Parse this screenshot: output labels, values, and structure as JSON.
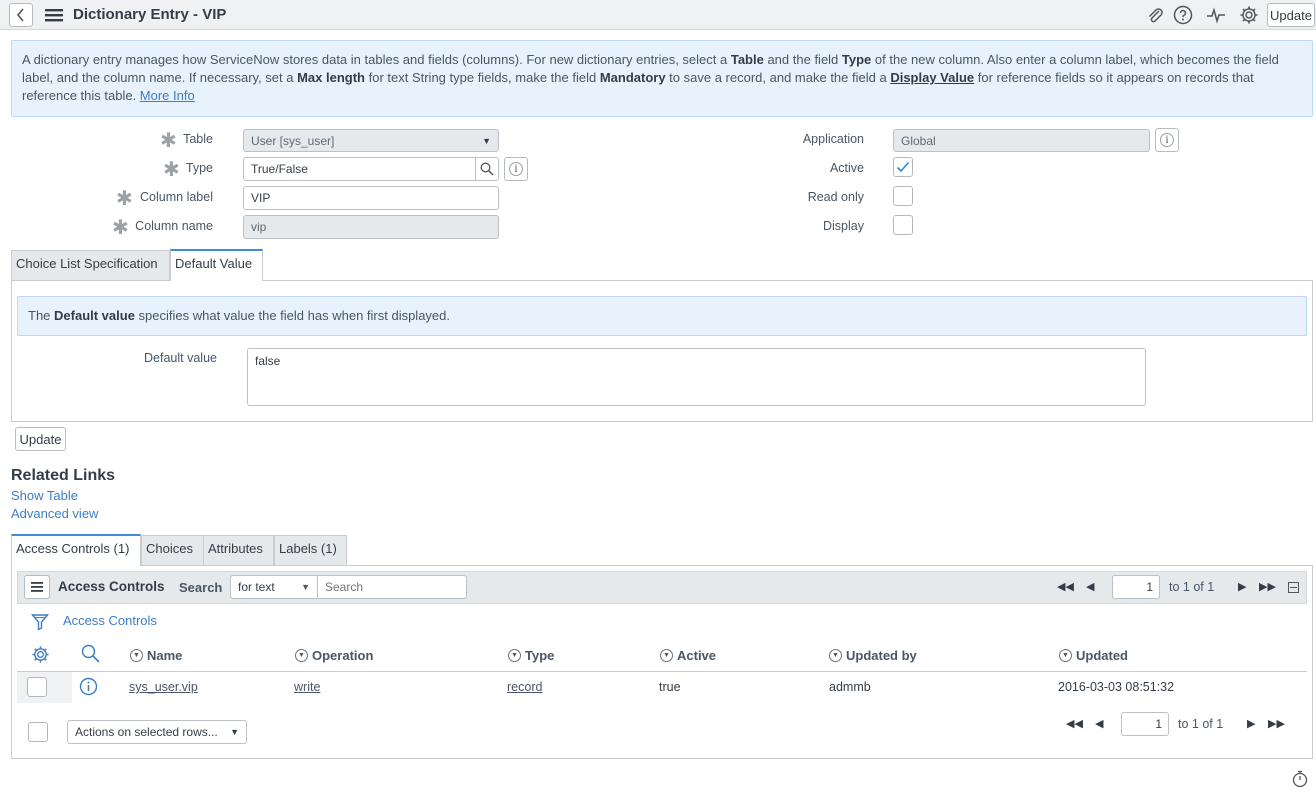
{
  "header": {
    "title": "Dictionary Entry - VIP",
    "update_label": "Update",
    "icons": [
      "back-icon",
      "menu-icon",
      "paperclip-icon",
      "help-icon",
      "activity-icon",
      "gear-icon"
    ]
  },
  "intro": {
    "t1": "A dictionary entry manages how ServiceNow stores data in tables and fields (columns). For new dictionary entries, select a ",
    "b1": "Table",
    "t2": " and the field ",
    "b2": "Type",
    "t3": " of the new column. Also enter a column label, which becomes the field label, and the column name. If necessary, set a ",
    "b3": "Max length",
    "t4": " for text String type fields, make the field ",
    "b4": "Mandatory",
    "t5": " to save a record, and make the field a ",
    "b5": "Display Value",
    "t6": " for reference fields so it appears on records that reference this table. ",
    "more_info": "More Info"
  },
  "form": {
    "table_label": "Table",
    "table_value": "User [sys_user]",
    "type_label": "Type",
    "type_value": "True/False",
    "column_label_label": "Column label",
    "column_label_value": "VIP",
    "column_name_label": "Column name",
    "column_name_value": "vip",
    "application_label": "Application",
    "application_value": "Global",
    "active_label": "Active",
    "active_checked": true,
    "read_only_label": "Read only",
    "read_only_checked": false,
    "display_label": "Display",
    "display_checked": false
  },
  "section_tabs": [
    "Choice List Specification",
    "Default Value"
  ],
  "default_value": {
    "note_pre": "The ",
    "note_bold": "Default value",
    "note_post": " specifies what value the field has when first displayed.",
    "label": "Default value",
    "value": "false"
  },
  "update_button": "Update",
  "related_links": {
    "title": "Related Links",
    "links": [
      "Show Table",
      "Advanced view"
    ]
  },
  "related_tabs": [
    "Access Controls (1)",
    "Choices",
    "Attributes",
    "Labels (1)"
  ],
  "list": {
    "title": "Access Controls",
    "search_label": "Search",
    "search_field": "for text",
    "search_placeholder": "Search",
    "breadcrumb": "Access Controls",
    "page": "1",
    "page_text": "to 1 of 1",
    "columns": [
      "Name",
      "Operation",
      "Type",
      "Active",
      "Updated by",
      "Updated"
    ],
    "rows": [
      {
        "name": "sys_user.vip",
        "operation": "write",
        "type": "record",
        "active": "true",
        "updated_by": "admmb",
        "updated": "2016-03-03 08:51:32"
      }
    ],
    "actions_label": "Actions on selected rows..."
  },
  "colors": {
    "accent": "#3d8bd9",
    "link": "#3b7ec6",
    "info_bg": "#e8f2fd"
  }
}
